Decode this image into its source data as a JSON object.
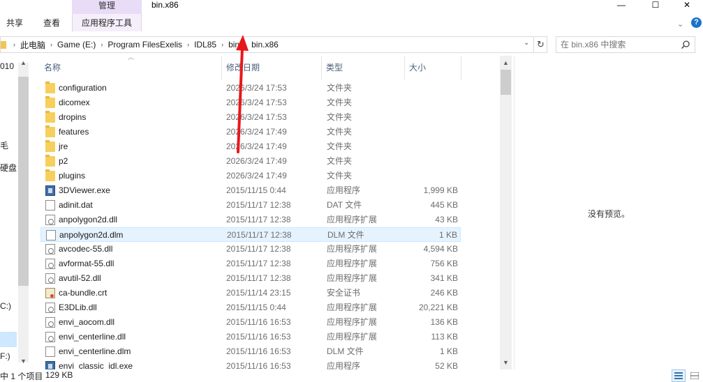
{
  "window": {
    "title": "bin.x86",
    "minimize_glyph": "—",
    "maximize_glyph": "☐",
    "close_glyph": "✕"
  },
  "ribbon": {
    "context_tab_header": "管理",
    "tabs": [
      "共享",
      "查看",
      "应用程序工具"
    ],
    "chevron_glyph": "⌄",
    "help_glyph": "?"
  },
  "address": {
    "crumbs": [
      "此电脑",
      "Game (E:)",
      "Program FilesExelis",
      "IDL85",
      "bin",
      "bin.x86"
    ],
    "separator": "›",
    "dropdown_glyph": "⌄",
    "refresh_glyph": "↻"
  },
  "search": {
    "placeholder": "在 bin.x86 中搜索"
  },
  "nav": {
    "fragments": [
      "010",
      "毛",
      "硬盘",
      "C:)",
      "F:)"
    ]
  },
  "columns": {
    "name": "名称",
    "date": "修改日期",
    "type": "类型",
    "size": "大小"
  },
  "files": [
    {
      "name": "configuration",
      "date": "2026/3/24 17:53",
      "type": "文件夹",
      "size": "",
      "icon": "folder"
    },
    {
      "name": "dicomex",
      "date": "2026/3/24 17:53",
      "type": "文件夹",
      "size": "",
      "icon": "folder"
    },
    {
      "name": "dropins",
      "date": "2026/3/24 17:53",
      "type": "文件夹",
      "size": "",
      "icon": "folder"
    },
    {
      "name": "features",
      "date": "2026/3/24 17:49",
      "type": "文件夹",
      "size": "",
      "icon": "folder"
    },
    {
      "name": "jre",
      "date": "2026/3/24 17:49",
      "type": "文件夹",
      "size": "",
      "icon": "folder"
    },
    {
      "name": "p2",
      "date": "2026/3/24 17:49",
      "type": "文件夹",
      "size": "",
      "icon": "folder"
    },
    {
      "name": "plugins",
      "date": "2026/3/24 17:49",
      "type": "文件夹",
      "size": "",
      "icon": "folder"
    },
    {
      "name": "3DViewer.exe",
      "date": "2015/11/15 0:44",
      "type": "应用程序",
      "size": "1,999 KB",
      "icon": "exe"
    },
    {
      "name": "adinit.dat",
      "date": "2015/11/17 12:38",
      "type": "DAT 文件",
      "size": "445 KB",
      "icon": "file"
    },
    {
      "name": "anpolygon2d.dll",
      "date": "2015/11/17 12:38",
      "type": "应用程序扩展",
      "size": "43 KB",
      "icon": "dll"
    },
    {
      "name": "anpolygon2d.dlm",
      "date": "2015/11/17 12:38",
      "type": "DLM 文件",
      "size": "1 KB",
      "icon": "file",
      "selected": true
    },
    {
      "name": "avcodec-55.dll",
      "date": "2015/11/17 12:38",
      "type": "应用程序扩展",
      "size": "4,594 KB",
      "icon": "dll"
    },
    {
      "name": "avformat-55.dll",
      "date": "2015/11/17 12:38",
      "type": "应用程序扩展",
      "size": "756 KB",
      "icon": "dll"
    },
    {
      "name": "avutil-52.dll",
      "date": "2015/11/17 12:38",
      "type": "应用程序扩展",
      "size": "341 KB",
      "icon": "dll"
    },
    {
      "name": "ca-bundle.crt",
      "date": "2015/11/14 23:15",
      "type": "安全证书",
      "size": "246 KB",
      "icon": "crt"
    },
    {
      "name": "E3DLib.dll",
      "date": "2015/11/15 0:44",
      "type": "应用程序扩展",
      "size": "20,221 KB",
      "icon": "dll"
    },
    {
      "name": "envi_aocom.dll",
      "date": "2015/11/16 16:53",
      "type": "应用程序扩展",
      "size": "136 KB",
      "icon": "dll"
    },
    {
      "name": "envi_centerline.dll",
      "date": "2015/11/16 16:53",
      "type": "应用程序扩展",
      "size": "113 KB",
      "icon": "dll"
    },
    {
      "name": "envi_centerline.dlm",
      "date": "2015/11/16 16:53",
      "type": "DLM 文件",
      "size": "1 KB",
      "icon": "file"
    },
    {
      "name": "envi_classic_idl.exe",
      "date": "2015/11/16 16:53",
      "type": "应用程序",
      "size": "52 KB",
      "icon": "exe"
    }
  ],
  "preview": {
    "message": "没有预览。"
  },
  "status": {
    "selection": "中 1 个项目",
    "size": "129 KB"
  },
  "colors": {
    "annotation_arrow": "#e8171b",
    "selection": "#e5f3ff",
    "context_tab": "#e8dcf7"
  }
}
